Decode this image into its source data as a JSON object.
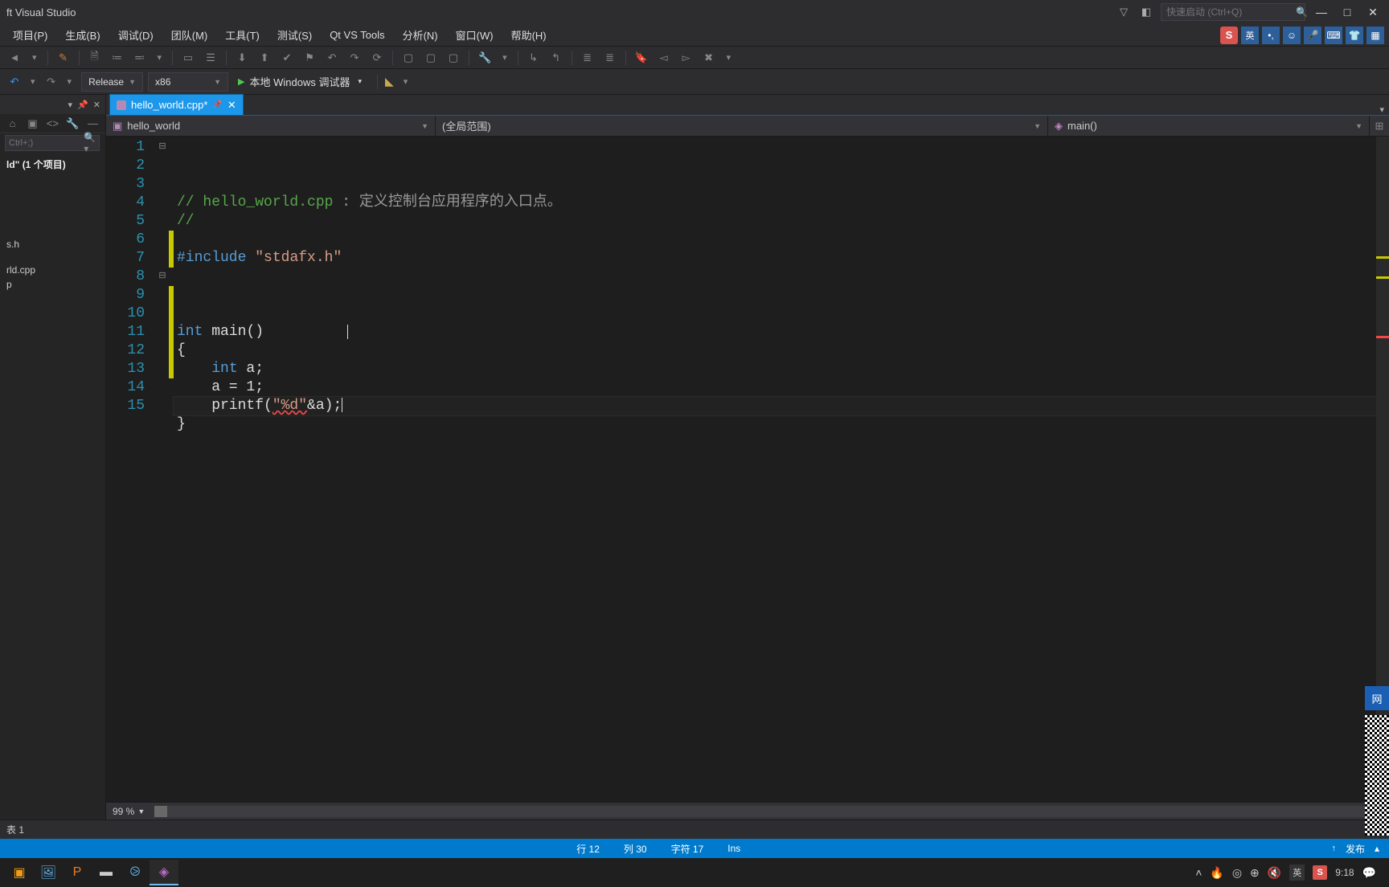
{
  "titlebar": {
    "app_title": "ft Visual Studio",
    "quick_launch_placeholder": "快速启动 (Ctrl+Q)"
  },
  "menu": {
    "items": [
      "项目(P)",
      "生成(B)",
      "调试(D)",
      "团队(M)",
      "工具(T)",
      "测试(S)",
      "Qt VS Tools",
      "分析(N)",
      "窗口(W)",
      "帮助(H)"
    ]
  },
  "ime": {
    "badge": "S",
    "lang": "英"
  },
  "toolbar2": {
    "config": "Release",
    "platform": "x86",
    "debugger": "本地 Windows 调试器"
  },
  "sidebar": {
    "search_placeholder": "Ctrl+;)",
    "solution_line": "ld\" (1 个项目)",
    "tree": [
      "s.h",
      "rld.cpp",
      "p"
    ]
  },
  "tabs": {
    "file": "hello_world.cpp*"
  },
  "context": {
    "project": "hello_world",
    "scope": "(全局范围)",
    "member": "main()"
  },
  "code": {
    "lines": [
      {
        "n": 1,
        "fold": "⊟",
        "html": "<span class='cmt'>// </span><span class='cmt'>hello_world.cpp</span><span class='cmt-dark'> : 定义控制台应用程序的入口点。</span>"
      },
      {
        "n": 2,
        "html": "<span class='cmt'>//</span>"
      },
      {
        "n": 3,
        "html": ""
      },
      {
        "n": 4,
        "html": "<span class='kw'>#include</span> <span class='str'>\"stdafx.h\"</span>"
      },
      {
        "n": 5,
        "html": ""
      },
      {
        "n": 6,
        "mod": true,
        "html": ""
      },
      {
        "n": 7,
        "mod": true,
        "html": ""
      },
      {
        "n": 8,
        "fold": "⊟",
        "html": "<span class='kw'>int</span> <span class='fn'>main</span>()"
      },
      {
        "n": 9,
        "mod": true,
        "html": "{"
      },
      {
        "n": 10,
        "mod": true,
        "html": "    <span class='kw'>int</span> a;"
      },
      {
        "n": 11,
        "mod": true,
        "html": "    a = 1;"
      },
      {
        "n": 12,
        "mod": true,
        "current": true,
        "html": "    printf(<span class='str err'>\"%d\"</span>&amp;a);<span class='cursor'></span>"
      },
      {
        "n": 13,
        "mod": true,
        "html": "}"
      },
      {
        "n": 14,
        "html": ""
      },
      {
        "n": 15,
        "html": ""
      }
    ]
  },
  "zoom": "99 %",
  "output_bar": "表 1",
  "status": {
    "line": "行 12",
    "col": "列 30",
    "char": "字符 17",
    "mode": "Ins",
    "publish": "发布"
  },
  "task": {
    "time": "9:18",
    "lang": "英"
  }
}
